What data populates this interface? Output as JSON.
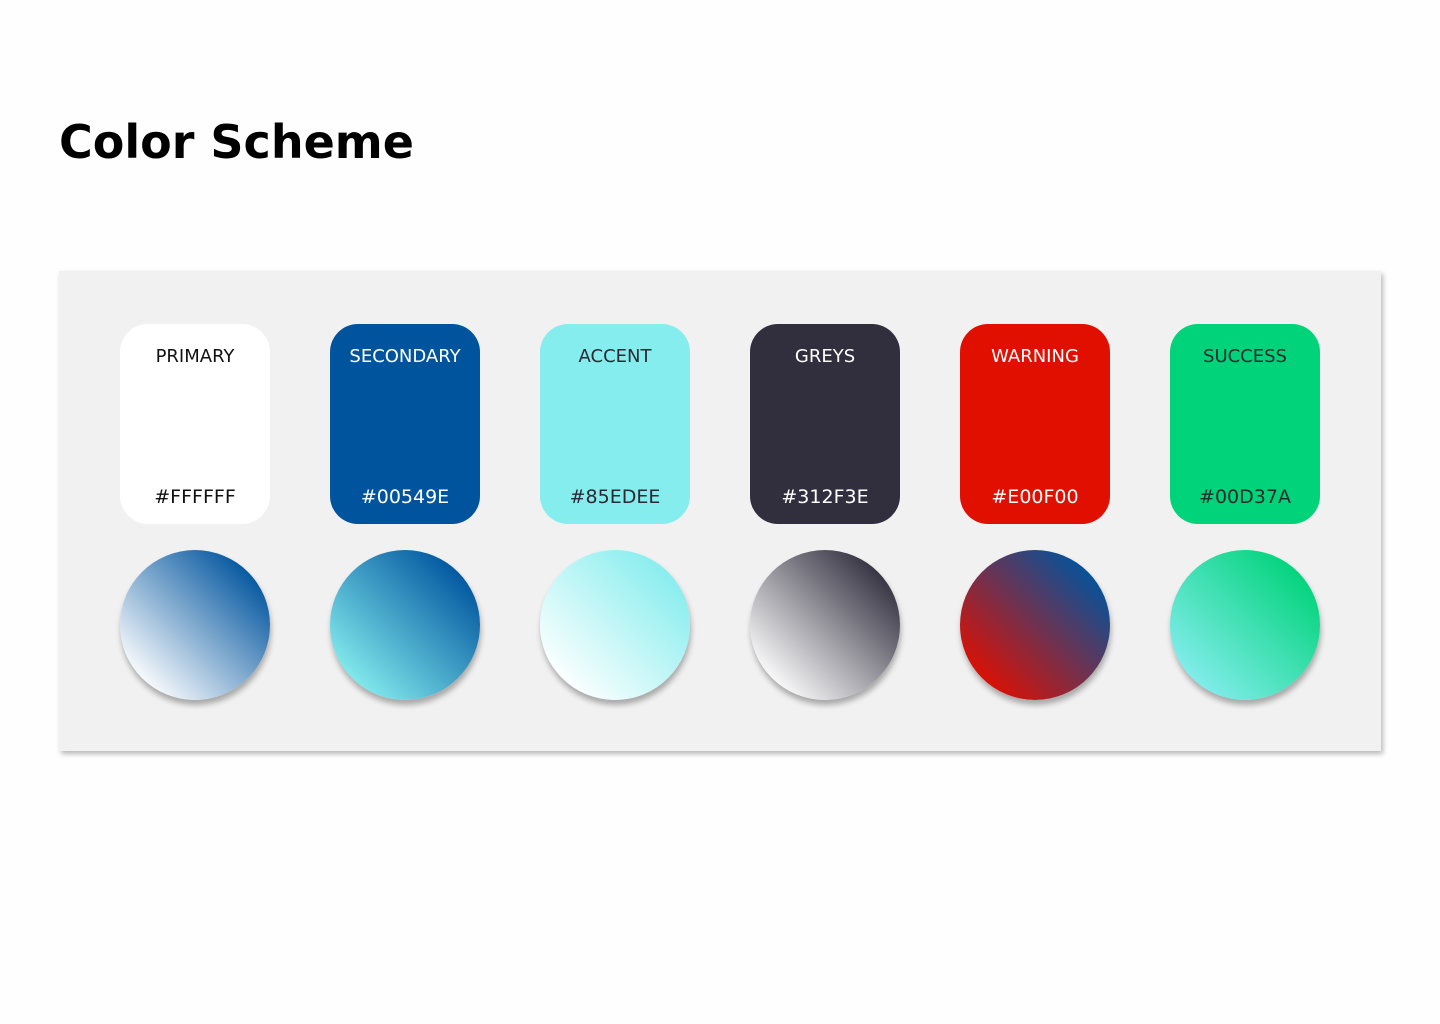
{
  "title": "Color Scheme",
  "swatches": [
    {
      "name": "PRIMARY",
      "hex": "#FFFFFF",
      "color": "#FFFFFF",
      "text_color": "#111111"
    },
    {
      "name": "SECONDARY",
      "hex": "#00549E",
      "color": "#00549E",
      "text_color": "#FFFFFF"
    },
    {
      "name": "ACCENT",
      "hex": "#85EDEE",
      "color": "#85EDEE",
      "text_color": "#2A2A33"
    },
    {
      "name": "GREYS",
      "hex": "#312F3E",
      "color": "#312F3E",
      "text_color": "#FFFFFF"
    },
    {
      "name": "WARNING",
      "hex": "#E00F00",
      "color": "#E00F00",
      "text_color": "#FFFFFF"
    },
    {
      "name": "SUCCESS",
      "hex": "#00D37A",
      "color": "#00D37A",
      "text_color": "#1F2A2A"
    }
  ],
  "gradients": [
    {
      "from": "#00549E",
      "to": "#FFFFFF"
    },
    {
      "from": "#00549E",
      "to": "#85EDEE"
    },
    {
      "from": "#85EDEE",
      "to": "#FFFFFF"
    },
    {
      "from": "#312F3E",
      "to": "#FFFFFF"
    },
    {
      "from": "#00549E",
      "to": "#E00F00"
    },
    {
      "from": "#00D37A",
      "to": "#85EDEE"
    }
  ]
}
